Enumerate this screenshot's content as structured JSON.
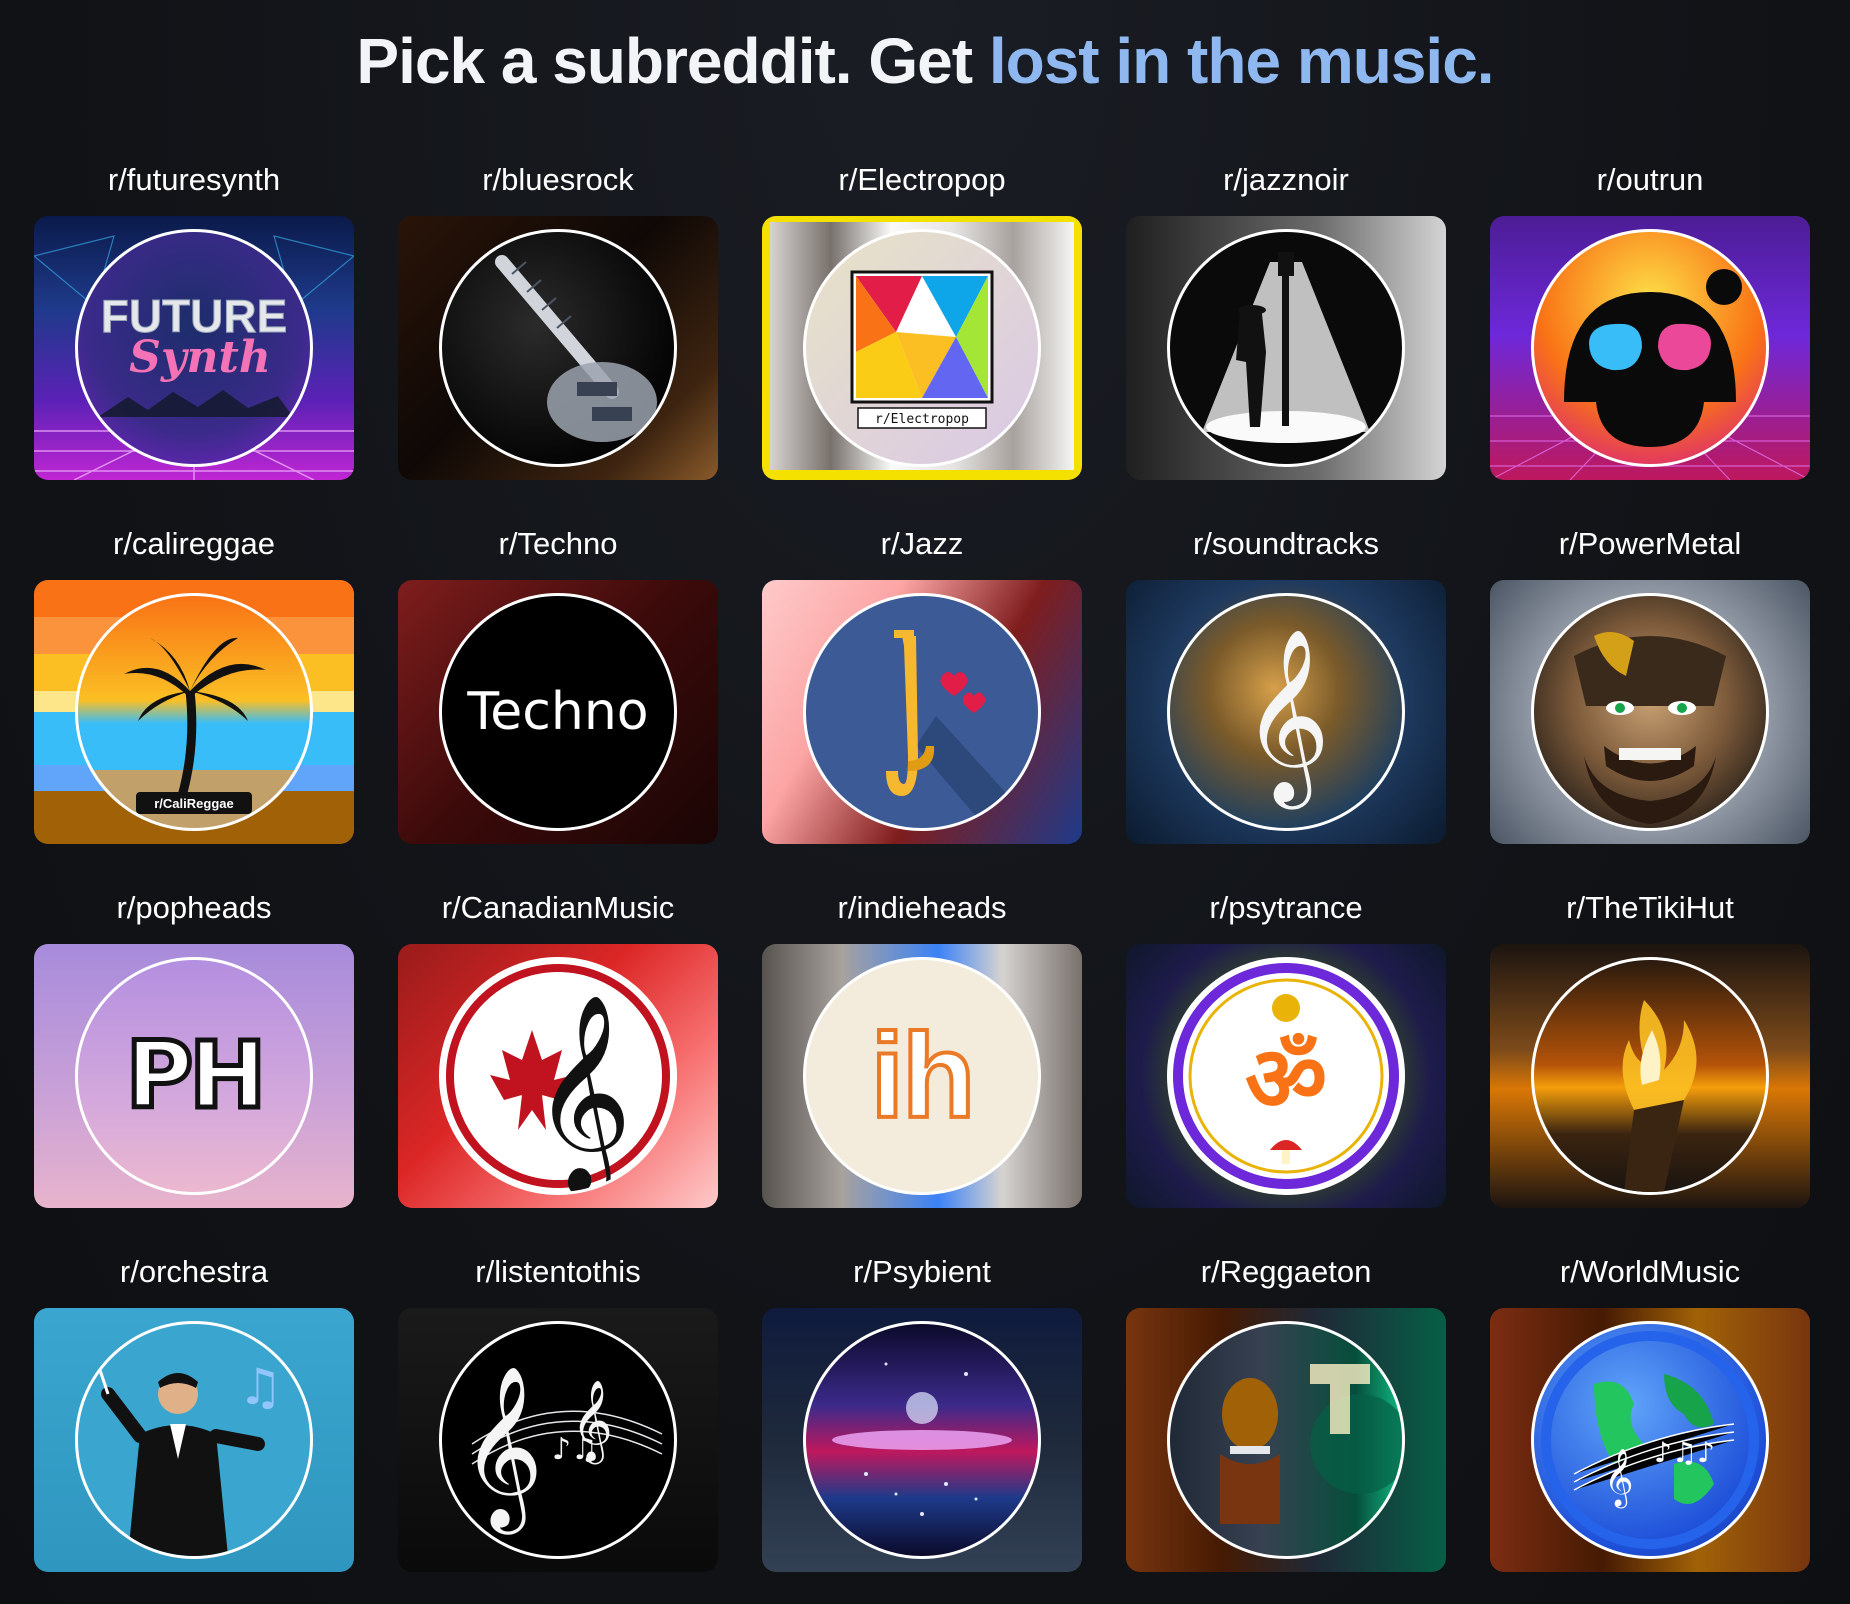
{
  "headline": {
    "part1": "Pick a subreddit. Get ",
    "part2": "lost in the music."
  },
  "colors": {
    "accent": "#8fb8f0",
    "background": "#0f1114"
  },
  "subreddits": [
    {
      "name": "r/futuresynth",
      "icon": "futuresynth-logo-icon"
    },
    {
      "name": "r/bluesrock",
      "icon": "electric-guitar-icon"
    },
    {
      "name": "r/Electropop",
      "icon": "electropop-logo-icon",
      "badge": "r/Electropop"
    },
    {
      "name": "r/jazznoir",
      "icon": "lamppost-silhouette-icon"
    },
    {
      "name": "r/outrun",
      "icon": "sunglasses-alien-icon"
    },
    {
      "name": "r/calireggae",
      "icon": "palm-tree-sunset-icon",
      "badge": "r/CaliReggae"
    },
    {
      "name": "r/Techno",
      "icon": "techno-text-icon",
      "text": "Techno"
    },
    {
      "name": "r/Jazz",
      "icon": "saxophone-icon"
    },
    {
      "name": "r/soundtracks",
      "icon": "treble-clef-icon"
    },
    {
      "name": "r/PowerMetal",
      "icon": "warrior-face-icon"
    },
    {
      "name": "r/popheads",
      "icon": "ph-logo-icon",
      "text": "PH"
    },
    {
      "name": "r/CanadianMusic",
      "icon": "maple-leaf-clef-icon"
    },
    {
      "name": "r/indieheads",
      "icon": "ih-logo-icon",
      "text": "ih"
    },
    {
      "name": "r/psytrance",
      "icon": "om-symbol-icon"
    },
    {
      "name": "r/TheTikiHut",
      "icon": "tiki-torch-icon"
    },
    {
      "name": "r/orchestra",
      "icon": "conductor-icon"
    },
    {
      "name": "r/listentothis",
      "icon": "music-notes-icon"
    },
    {
      "name": "r/Psybient",
      "icon": "cosmic-landscape-icon"
    },
    {
      "name": "r/Reggaeton",
      "icon": "reggaeton-collage-icon"
    },
    {
      "name": "r/WorldMusic",
      "icon": "globe-music-icon"
    }
  ]
}
